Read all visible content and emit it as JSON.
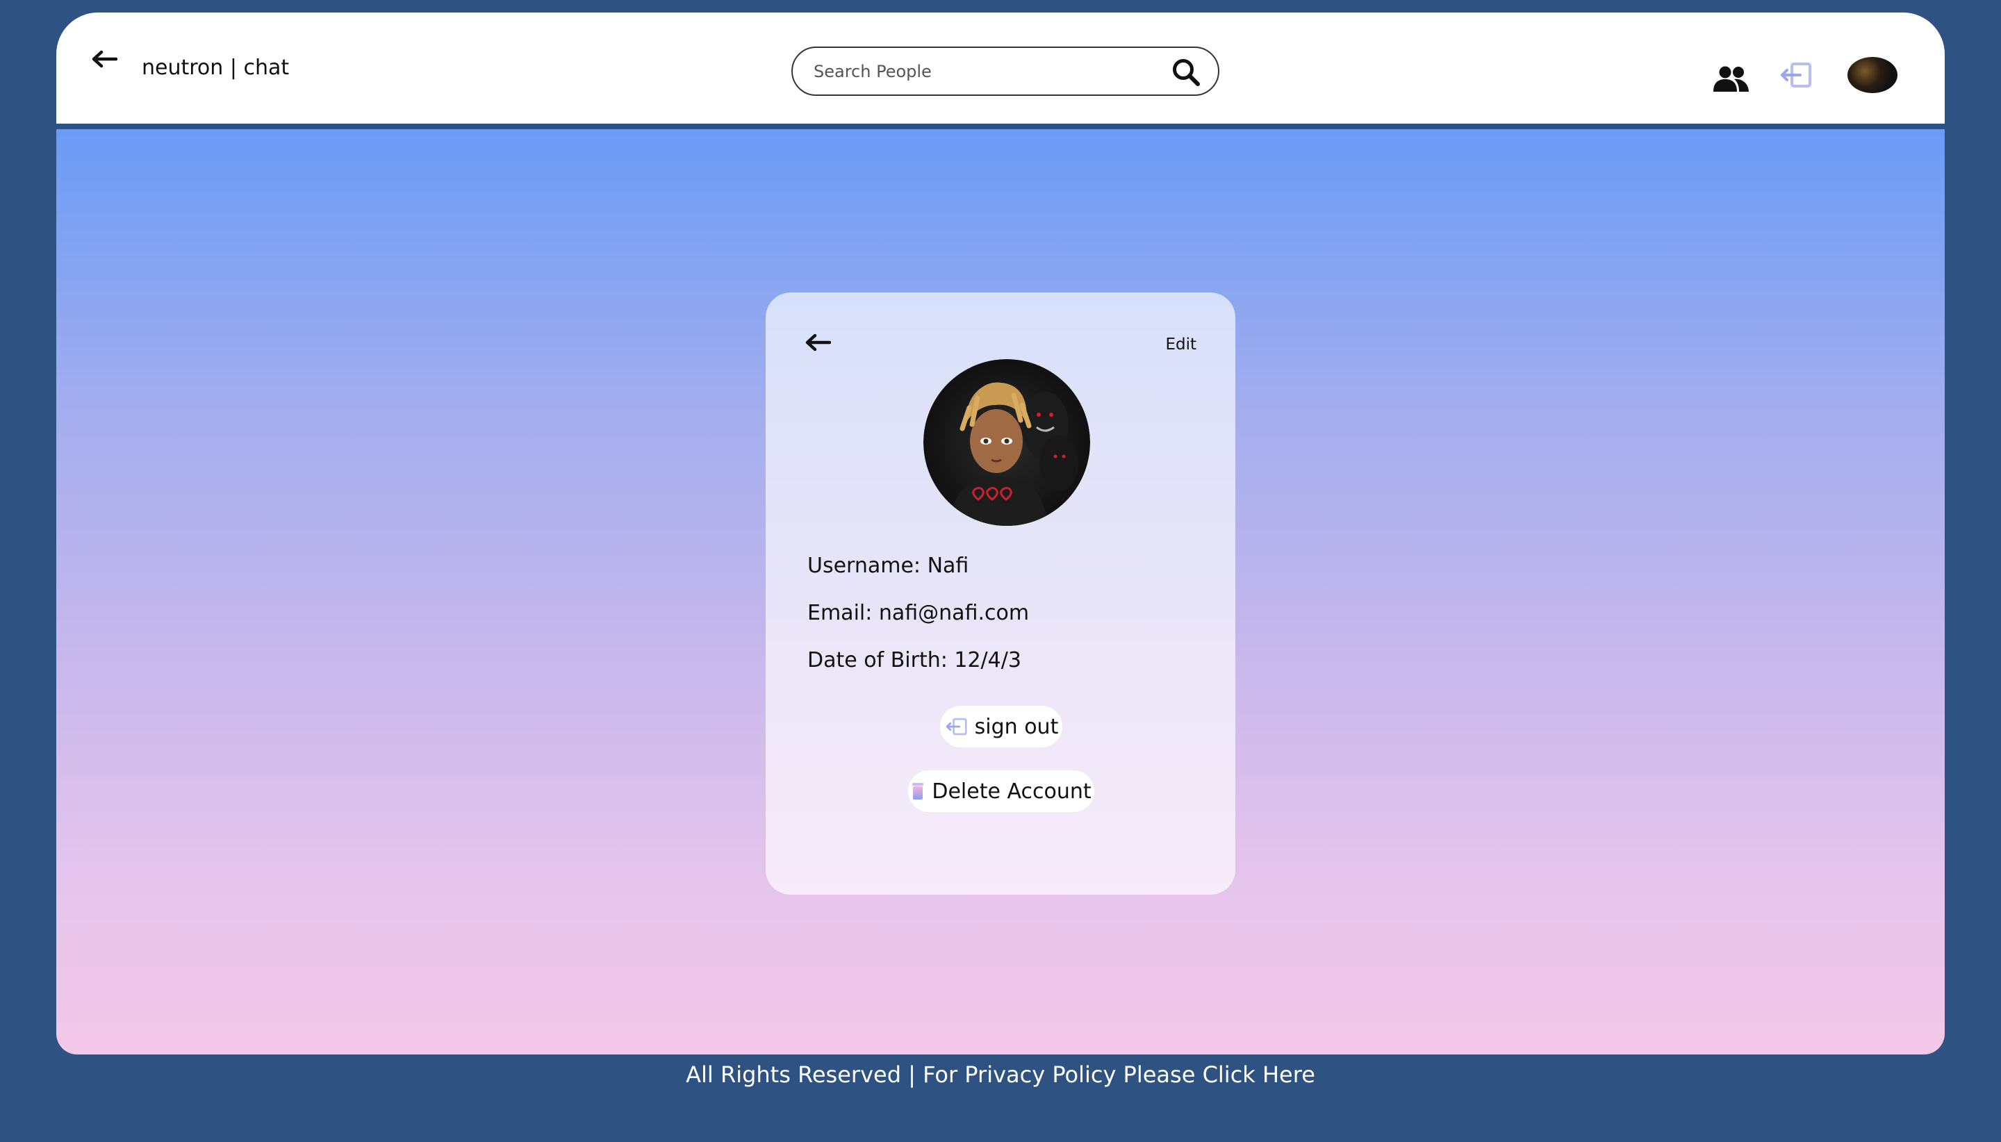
{
  "header": {
    "brand": "neutron | chat",
    "search": {
      "placeholder": "Search People",
      "value": ""
    },
    "icons": [
      "back-arrow-icon",
      "search-icon",
      "people-icon",
      "sign-out-icon",
      "avatar"
    ]
  },
  "profile": {
    "edit_label": "Edit",
    "username": "Username: Nafi",
    "email": "Email: nafi@nafi.com",
    "dob": "Date of Birth: 12/4/3",
    "sign_out_label": "sign out",
    "delete_label": "Delete Account"
  },
  "footer": {
    "text": "All Rights Reserved | For Privacy Policy Please Click Here"
  },
  "colors": {
    "page_background": "#2e5282",
    "topbar": "#ffffff",
    "gradient_top": "#6a9bf5",
    "gradient_bottom": "#f4c8e8",
    "accent_icon": "#a9b4f5"
  }
}
